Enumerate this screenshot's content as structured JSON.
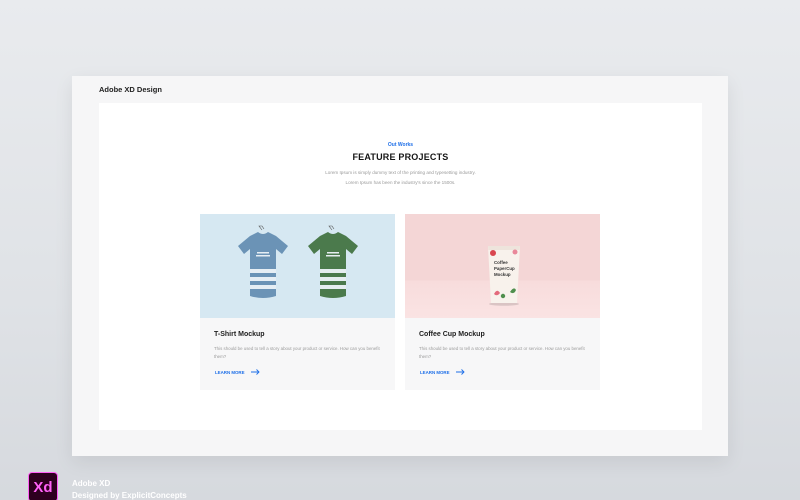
{
  "artboard": {
    "title": "Adobe XD Design"
  },
  "section": {
    "eyebrow": "Out Works",
    "heading": "FEATURE PROJECTS",
    "subtitle_line1": "Lorem Ipsum is simply dummy text of the printing and typesetting industry.",
    "subtitle_line2": "Lorem Ipsum has been the industry's since the 1500s."
  },
  "cards": [
    {
      "title": "T-Shirt Mockup",
      "description": "This should be used to tell a story about your product or service. How can you benefit them?",
      "link_label": "LEARN MORE",
      "image_icon": "t-shirt-mockup-image"
    },
    {
      "title": "Coffee Cup Mockup",
      "description": "This should be used to tell a story about your product or service. How can you benefit them?",
      "link_label": "LEARN MORE",
      "image_icon": "coffee-cup-mockup-image",
      "cup_label": [
        "Coffee",
        "PaperCup",
        "Mockup"
      ]
    }
  ],
  "footer": {
    "logo_text": "Xd",
    "app_name": "Adobe XD",
    "credit": "Designed by ExplicitConcepts"
  },
  "colors": {
    "accent": "#1e6fe8",
    "shirt_blue": "#6b93b6",
    "shirt_green": "#4b7a4c",
    "xd_pink": "#ff61f6",
    "xd_bg": "#2e001f"
  }
}
